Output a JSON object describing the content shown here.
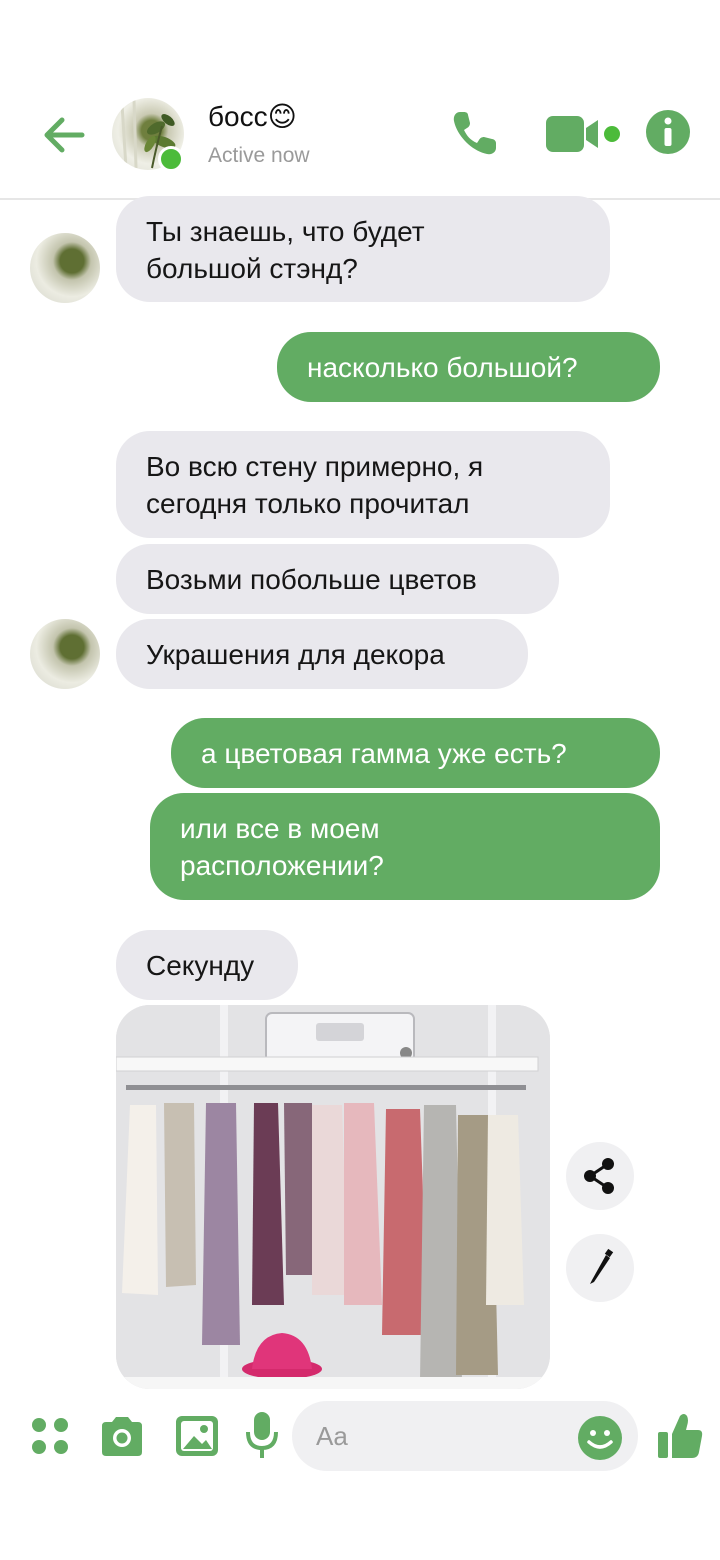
{
  "header": {
    "contact_name": "босс😊",
    "status": "Active now"
  },
  "messages": [
    {
      "side": "in",
      "text": "Ты знаешь, что будет\nбольшой стэнд?"
    },
    {
      "side": "out",
      "text": "насколько большой?"
    },
    {
      "side": "in",
      "text": "Во всю стену примерно, я\nсегодня только прочитал"
    },
    {
      "side": "in",
      "text": "Возьми побольше цветов"
    },
    {
      "side": "in",
      "text": "Украшения для декора"
    },
    {
      "side": "out",
      "text": "а цветовая гамма уже есть?"
    },
    {
      "side": "out",
      "text": "или все в моем\nрасположении?"
    },
    {
      "side": "in",
      "text": "Секунду"
    }
  ],
  "composer": {
    "placeholder": "Aa"
  },
  "icons": {
    "back": "arrow-left-icon",
    "call": "phone-icon",
    "video": "video-camera-icon",
    "info": "info-icon",
    "share": "share-icon",
    "edit": "pencil-icon",
    "menu": "four-dots-icon",
    "camera": "camera-icon",
    "gallery": "image-icon",
    "mic": "microphone-icon",
    "emoji": "smiley-icon",
    "like": "thumbs-up-icon"
  },
  "colors": {
    "accent": "#62ac63",
    "incoming_bubble": "#e9e8ed",
    "online": "#4cbb3a"
  }
}
